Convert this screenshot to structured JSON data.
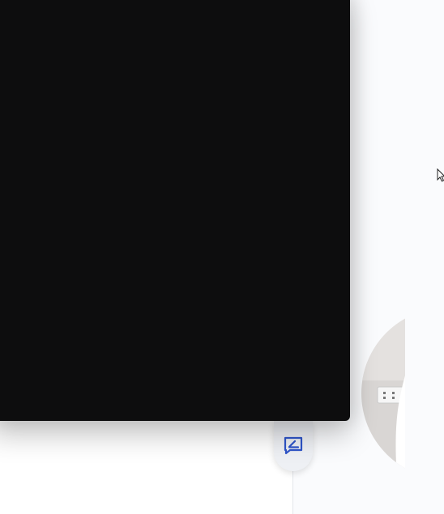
{
  "icons": {
    "feedback": "feedback-edit-icon",
    "cursor": "mouse-pointer-icon"
  },
  "colors": {
    "video_background": "#0d0d0e",
    "feedback_icon": "#2f55c9",
    "feedback_button_bg": "#eef0f4",
    "page_background": "#fdfdfe"
  }
}
